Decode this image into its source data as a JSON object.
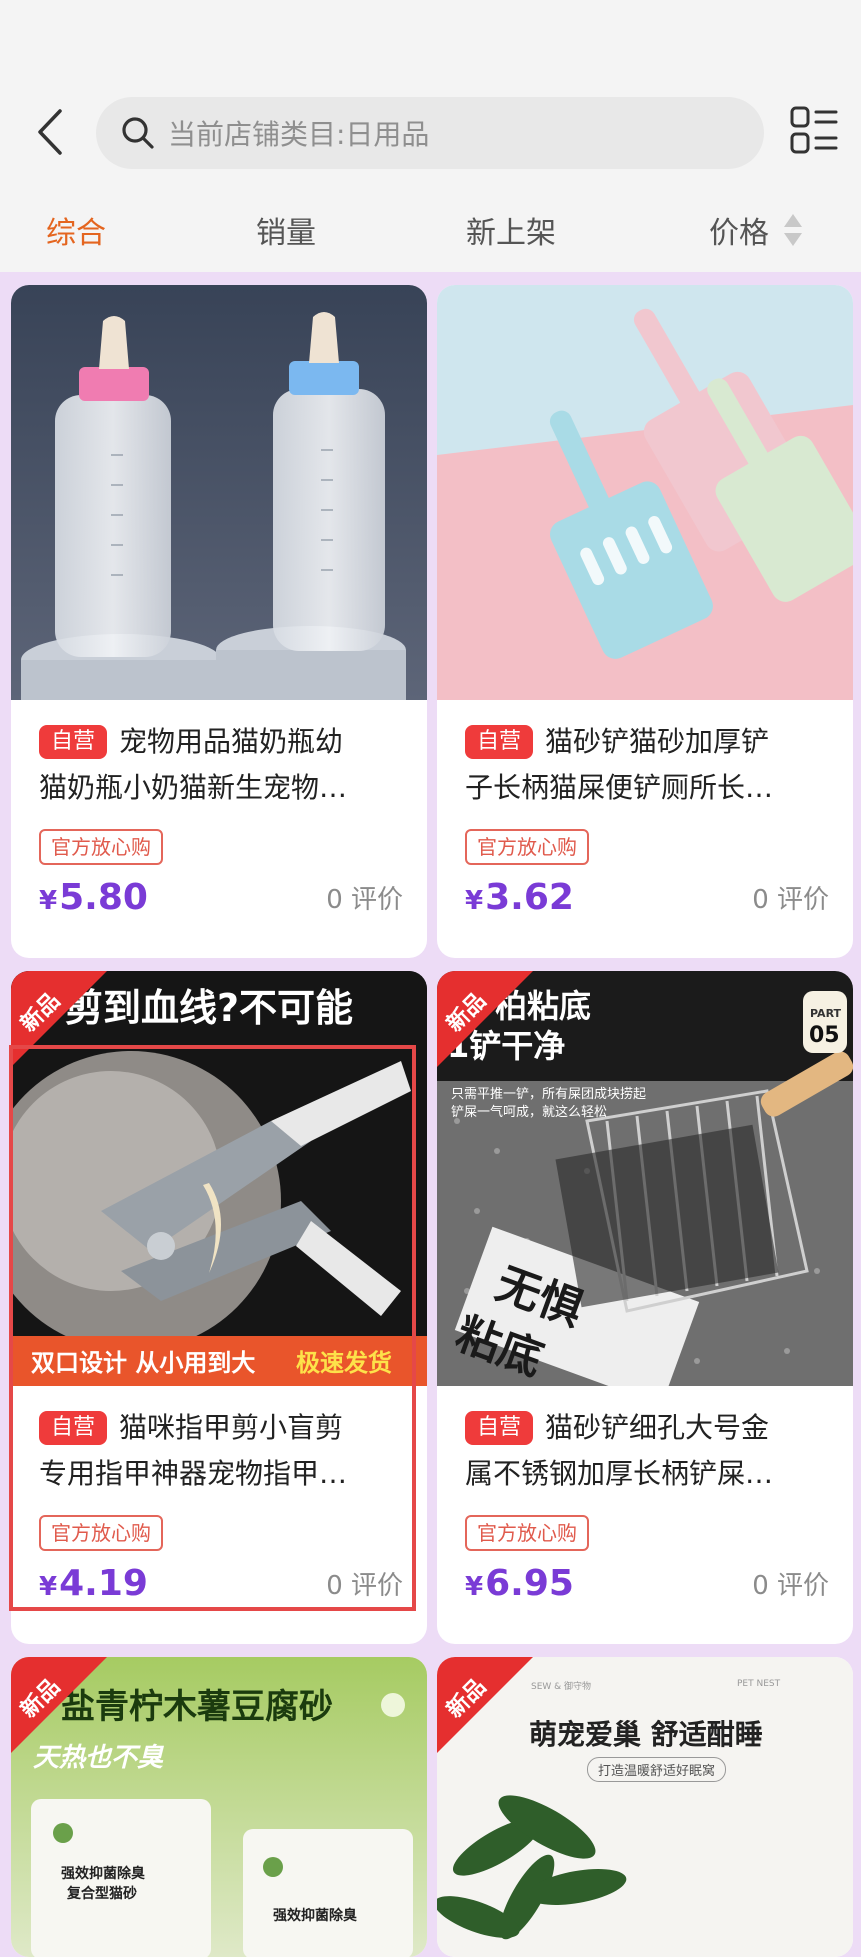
{
  "search": {
    "placeholder": "当前店铺类目:日用品"
  },
  "sort_tabs": [
    {
      "label": "综合",
      "active": true
    },
    {
      "label": "销量",
      "active": false
    },
    {
      "label": "新上架",
      "active": false
    },
    {
      "label": "价格",
      "active": false
    }
  ],
  "colors": {
    "accent": "#e4651f",
    "price": "#7a3bd6",
    "badge": "#ef3b3b",
    "background": "#eddcf6"
  },
  "products": [
    {
      "badge": "自营",
      "title_l1": "宠物用品猫奶瓶幼",
      "title_l2": "猫奶瓶小奶猫新生宠物…",
      "guarantee": "官方放心购",
      "currency": "¥",
      "price": "5.80",
      "reviews": "0 评价",
      "is_new": false
    },
    {
      "badge": "自营",
      "title_l1": "猫砂铲猫砂加厚铲",
      "title_l2": "子长柄猫屎便铲厕所长…",
      "guarantee": "官方放心购",
      "currency": "¥",
      "price": "3.62",
      "reviews": "0 评价",
      "is_new": false
    },
    {
      "badge": "自营",
      "title_l1": "猫咪指甲剪小盲剪",
      "title_l2": "专用指甲神器宠物指甲…",
      "guarantee": "官方放心购",
      "currency": "¥",
      "price": "4.19",
      "reviews": "0 评价",
      "is_new": true,
      "new_label": "新品",
      "banner_top": "剪到血线?不可能",
      "banner_bottom": "双口设计 从小用到大",
      "banner_bottom_right": "极速发货"
    },
    {
      "badge": "自营",
      "title_l1": "猫砂铲细孔大号金",
      "title_l2": "属不锈钢加厚长柄铲屎…",
      "guarantee": "官方放心购",
      "currency": "¥",
      "price": "6.95",
      "reviews": "0 评价",
      "is_new": true,
      "new_label": "新品",
      "banner_top": "柏粘底",
      "banner_top2": "1铲干净",
      "banner_sub": "只需平推一铲，所有屎团成块捞起",
      "banner_sub2": "铲屎一气呵成，就这么轻松",
      "part_label": "PART",
      "part_number": "05",
      "banner_mid": "无惧",
      "banner_mid2": "粘底"
    },
    {
      "new_label": "新品",
      "is_new": true,
      "banner_top": "盐青柠木薯豆腐砂",
      "banner_sub": "天热也不臭",
      "pack_label": "强效抑菌除臭",
      "pack_label2": "复合型猫砂",
      "pack_label3": "强效抑菌除臭"
    },
    {
      "new_label": "新品",
      "is_new": true,
      "banner_top": "萌宠爱巢 舒适酣睡",
      "banner_sub": "打造温暖舒适好眠窝",
      "tiny_left": "SEW & 御守物",
      "tiny_right": "PET NEST"
    }
  ]
}
